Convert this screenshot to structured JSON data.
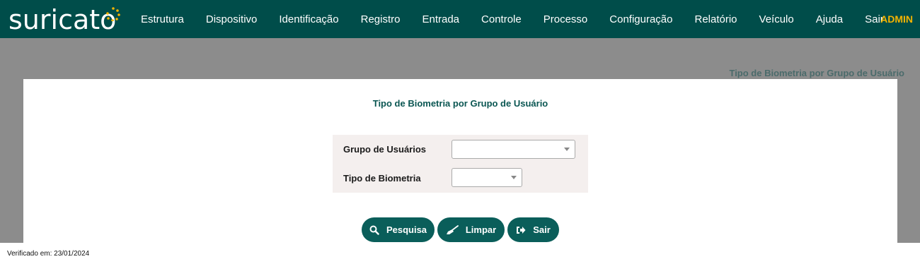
{
  "header": {
    "logo_text": "suricato",
    "nav": [
      "Estrutura",
      "Dispositivo",
      "Identificação",
      "Registro",
      "Entrada",
      "Controle",
      "Processo",
      "Configuração",
      "Relatório",
      "Veículo",
      "Ajuda",
      "Sair"
    ],
    "user": "ADMIN"
  },
  "breadcrumb": "Tipo de Biometria por Grupo de Usuário",
  "form": {
    "title": "Tipo de Biometria por Grupo de Usuário",
    "grupo_label": "Grupo de Usuários",
    "grupo_value": "",
    "tipo_label": "Tipo de Biometria",
    "tipo_value": ""
  },
  "buttons": {
    "pesquisa": "Pesquisa",
    "limpar": "Limpar",
    "sair": "Sair"
  },
  "footer": "Verificado em: 23/01/2024",
  "colors": {
    "header_bg": "#004d4a",
    "accent": "#0a5e5a",
    "admin": "#f5b400",
    "logo_dots": "#f5b400"
  }
}
